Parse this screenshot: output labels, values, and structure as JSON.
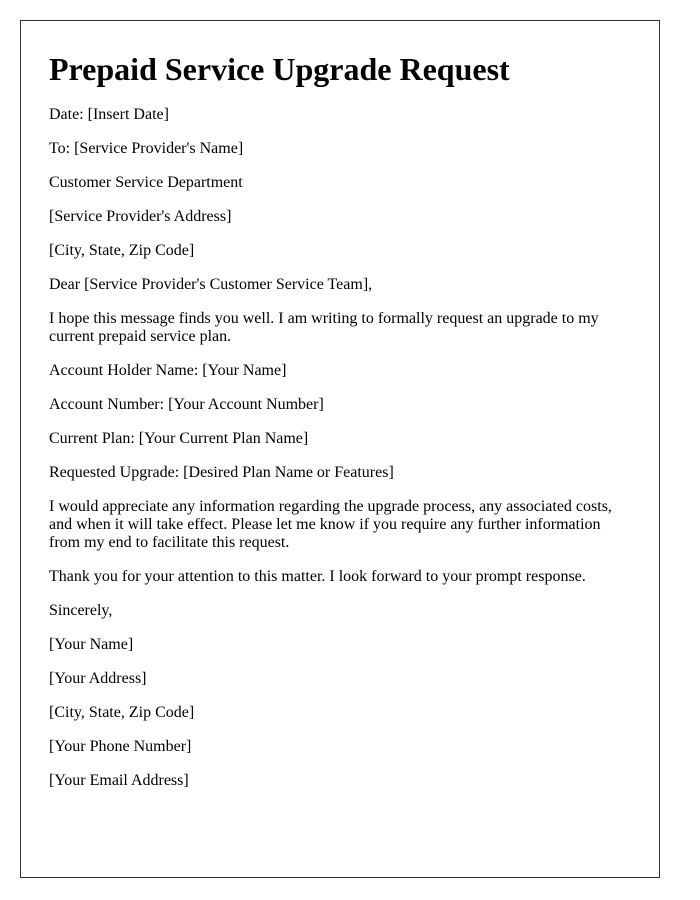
{
  "title": "Prepaid Service Upgrade Request",
  "header_lines": [
    "Date: [Insert Date]",
    "To: [Service Provider's Name]",
    "Customer Service Department",
    "[Service Provider's Address]",
    "[City, State, Zip Code]"
  ],
  "salutation": "Dear [Service Provider's Customer Service Team],",
  "intro": "I hope this message finds you well. I am writing to formally request an upgrade to my current prepaid service plan.",
  "details": [
    "Account Holder Name: [Your Name]",
    "Account Number: [Your Account Number]",
    "Current Plan: [Your Current Plan Name]",
    "Requested Upgrade: [Desired Plan Name or Features]"
  ],
  "body": "I would appreciate any information regarding the upgrade process, any associated costs, and when it will take effect. Please let me know if you require any further information from my end to facilitate this request.",
  "closing_thanks": "Thank you for your attention to this matter. I look forward to your prompt response.",
  "signoff": "Sincerely,",
  "signature_lines": [
    "[Your Name]",
    "[Your Address]",
    "[City, State, Zip Code]",
    "[Your Phone Number]",
    "[Your Email Address]"
  ]
}
